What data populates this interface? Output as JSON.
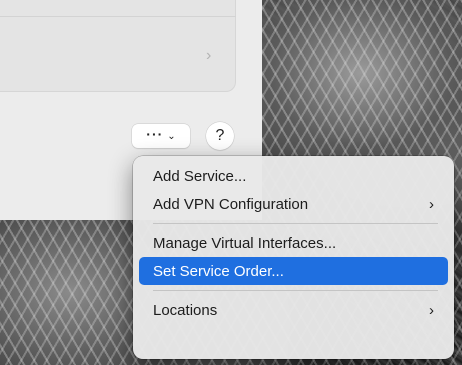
{
  "toolbar": {
    "more_dots": "···",
    "more_chevron": "⌄",
    "help_label": "?"
  },
  "panel": {
    "row_chevron": "›"
  },
  "menu": {
    "items": [
      {
        "label": "Add Service...",
        "submenu": false
      },
      {
        "label": "Add VPN Configuration",
        "submenu": true
      },
      {
        "label": "Manage Virtual Interfaces...",
        "submenu": false
      },
      {
        "label": "Set Service Order...",
        "submenu": false,
        "highlighted": true
      },
      {
        "label": "Locations",
        "submenu": true
      }
    ],
    "submenu_arrow": "›"
  },
  "colors": {
    "highlight": "#1f6fe0",
    "menu_bg": "#e8e8e8",
    "window_bg": "#ececec"
  }
}
